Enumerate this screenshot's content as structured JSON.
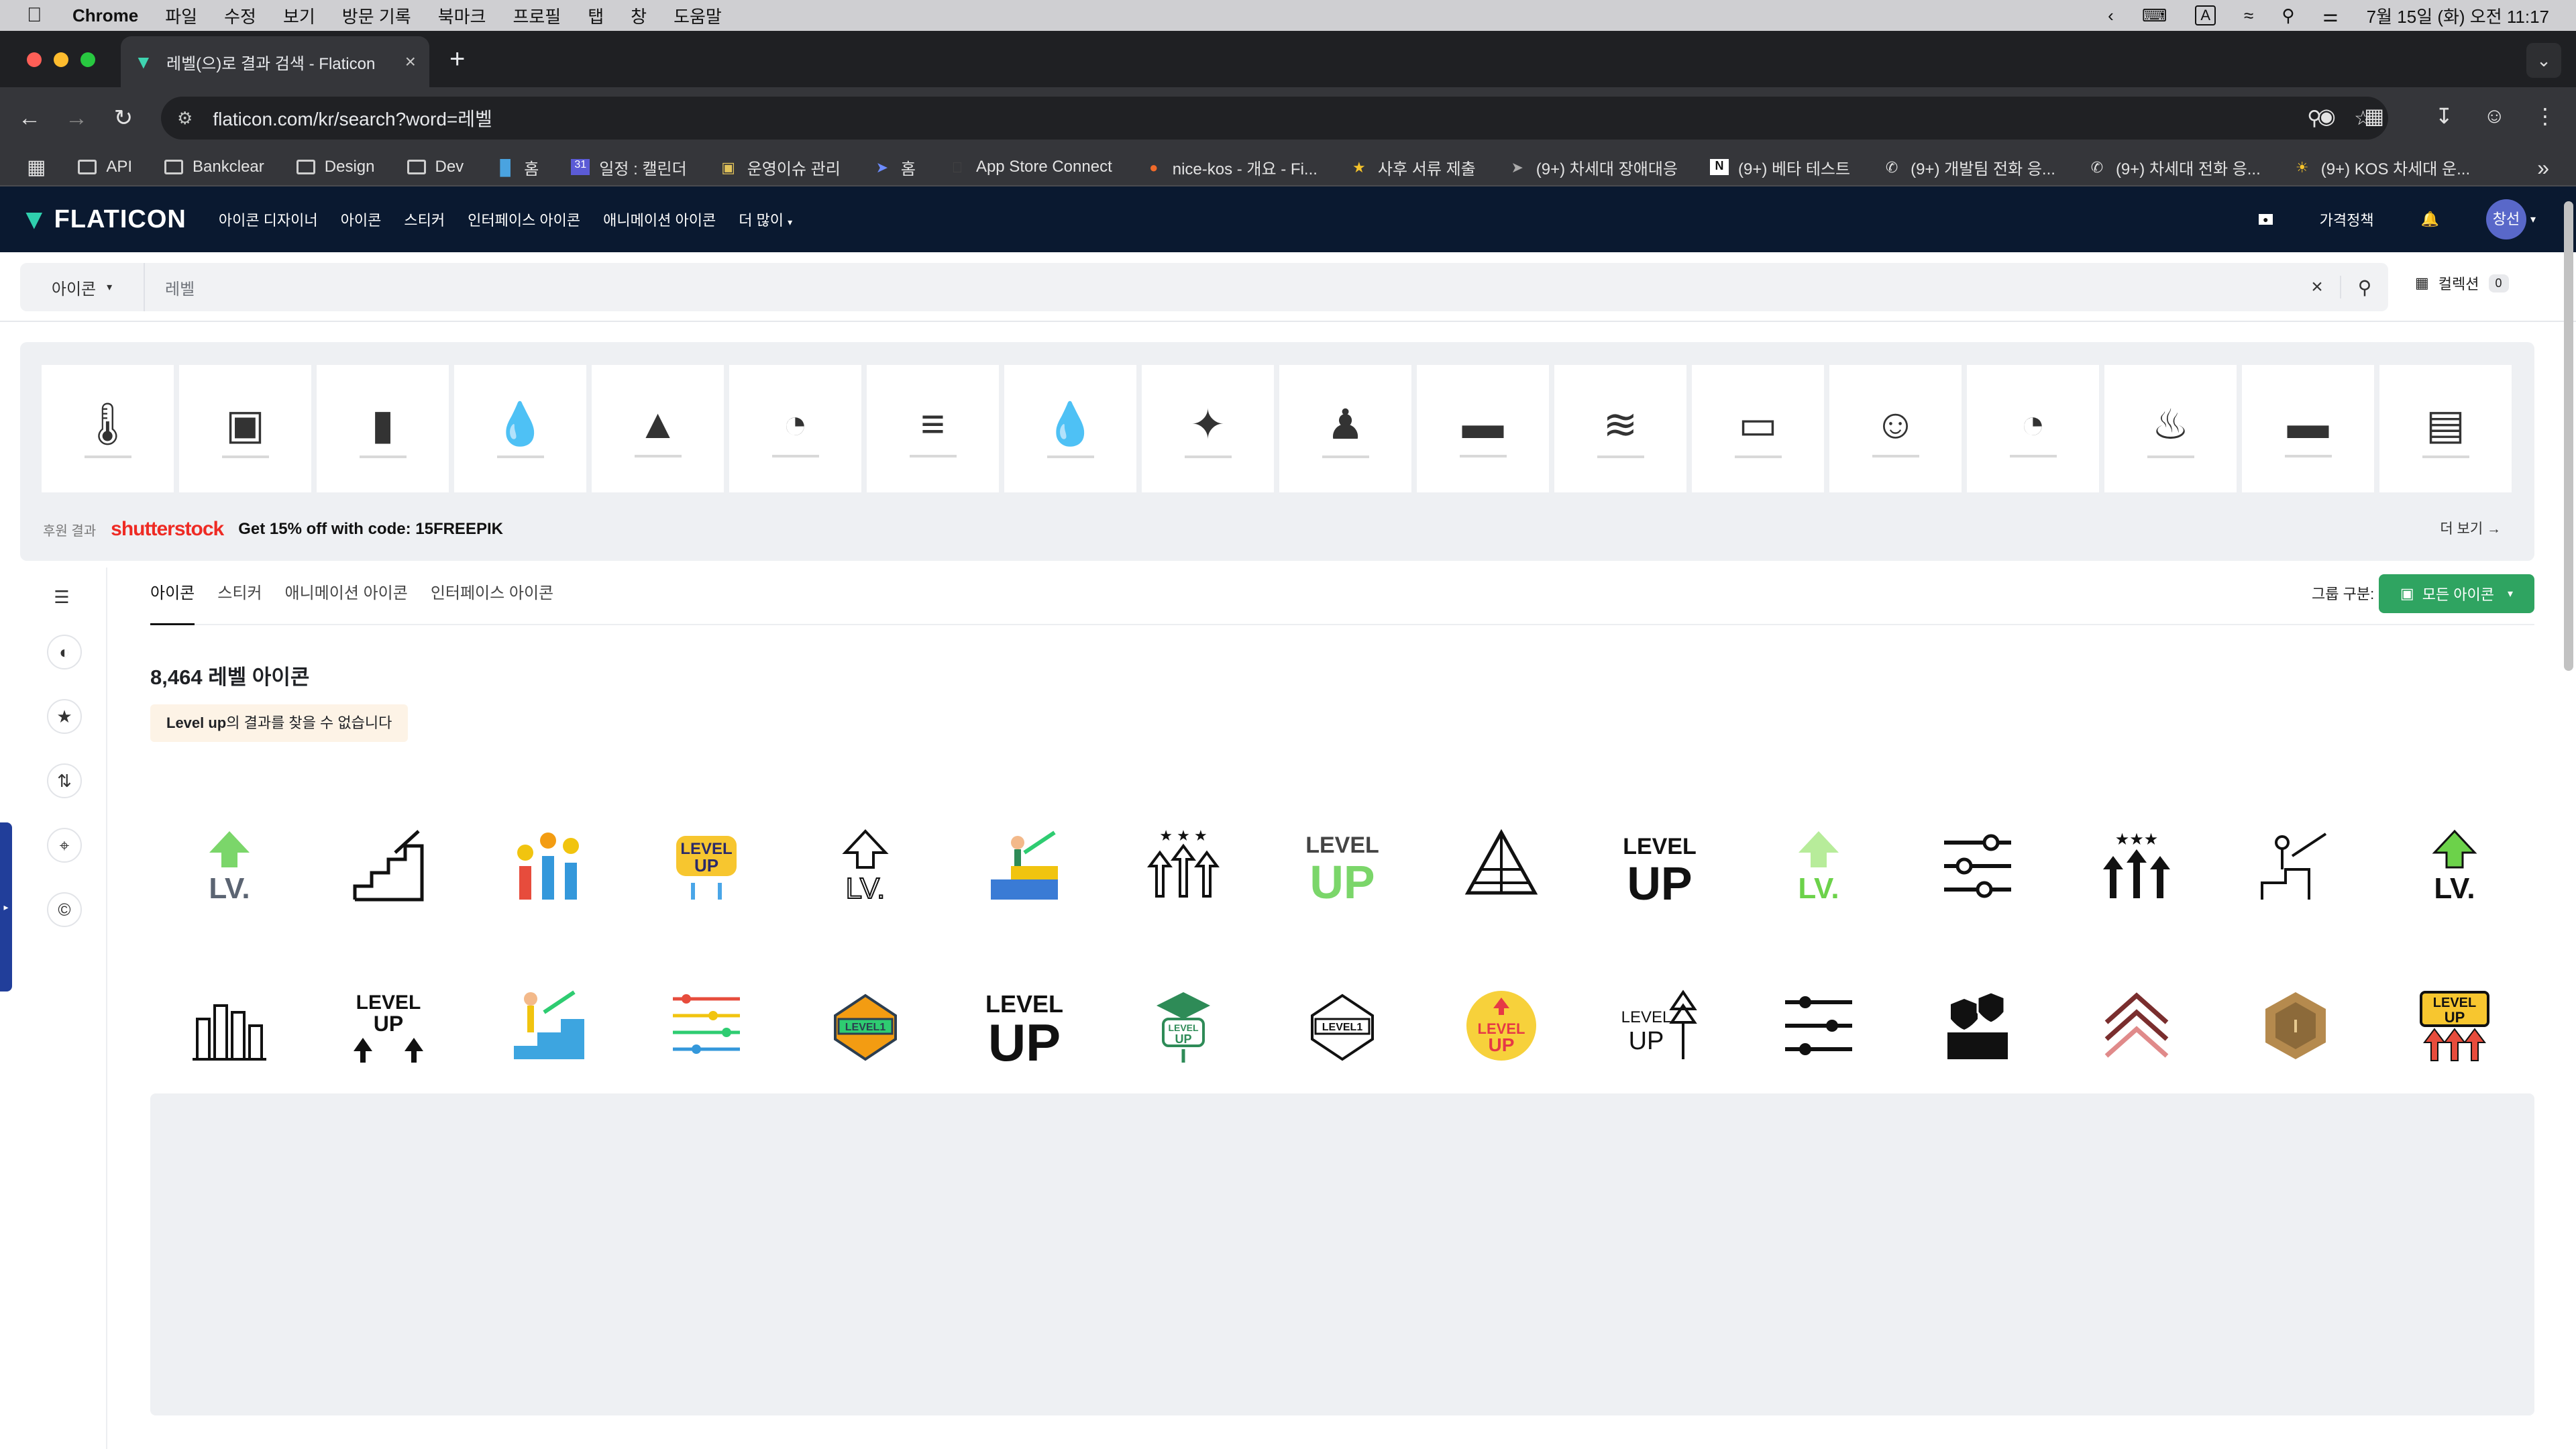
{
  "menubar": {
    "app": "Chrome",
    "items": [
      "파일",
      "수정",
      "보기",
      "방문 기록",
      "북마크",
      "프로필",
      "탭",
      "창",
      "도움말"
    ],
    "clock": "7월 15일 (화) 오전 11:17",
    "input_indicator": "A"
  },
  "browser": {
    "tab_title": "레벨(으)로 결과 검색 - Flaticon",
    "url": "flaticon.com/kr/search?word=레벨",
    "bookmarks": [
      {
        "label": "API",
        "icon": "folder-icon"
      },
      {
        "label": "Bankclear",
        "icon": "folder-icon"
      },
      {
        "label": "Design",
        "icon": "folder-icon"
      },
      {
        "label": "Dev",
        "icon": "folder-icon"
      },
      {
        "label": "홈",
        "icon": "site-icon"
      },
      {
        "label": "일정 : 캘린더",
        "icon": "calendar-icon"
      },
      {
        "label": "운영이슈 관리",
        "icon": "site-icon"
      },
      {
        "label": "홈",
        "icon": "site-icon"
      },
      {
        "label": "App Store Connect",
        "icon": "apple-icon"
      },
      {
        "label": "nice-kos - 개요 - Fi...",
        "icon": "site-icon"
      },
      {
        "label": "사후 서류 제출",
        "icon": "site-icon"
      },
      {
        "label": "(9+) 차세대 장애대응",
        "icon": "site-icon"
      },
      {
        "label": "(9+) 베타 테스트",
        "icon": "notion-icon"
      },
      {
        "label": "(9+) 개발팀 전화 응...",
        "icon": "phone-icon"
      },
      {
        "label": "(9+) 차세대 전화 응...",
        "icon": "phone-icon"
      },
      {
        "label": "(9+) KOS 차세대 운...",
        "icon": "sun-icon"
      }
    ]
  },
  "header": {
    "logo": "FLATICON",
    "nav": [
      "아이콘 디자이너",
      "아이콘",
      "스티커",
      "인터페이스 아이콘",
      "애니메이션 아이콘",
      "더 많이"
    ],
    "pricing": "가격정책",
    "avatar": "창선"
  },
  "search": {
    "type": "아이콘",
    "query": "레벨",
    "collections_label": "컬렉션",
    "collections_count": "0"
  },
  "sponsored": {
    "label": "후원 결과",
    "brand": "shutterstock",
    "promo": "Get 15% off with code: 15FREEPIK",
    "more": "더 보기 →",
    "tiles": [
      "thermometer-water-icon",
      "water-tank-icon",
      "ruler-level-icon",
      "water-drops-icon",
      "flood-mountain-icon",
      "gauge-speaker-icon",
      "water-ruler-icon",
      "humidity-percent-icon",
      "sparkle-level-icon",
      "climber-icon",
      "spirit-level-icon",
      "water-level-icon",
      "bubble-level-icon",
      "head-thought-icon",
      "gauge-meter-icon",
      "oil-can-icon",
      "tape-level-icon",
      "roof-rain-icon"
    ]
  },
  "tabs": [
    "아이콘",
    "스티커",
    "애니메이션 아이콘",
    "인터페이스 아이콘"
  ],
  "group": {
    "label": "그룹 구분:",
    "button": "모든 아이콘"
  },
  "results": {
    "count_text": "8,464 레벨 아이콘",
    "no_result_bold": "Level up",
    "no_result_rest": "의 결과를 찾을 수 없습니다"
  },
  "colors": {
    "header_bg": "#0a1930",
    "accent_green": "#2fa461",
    "brand_teal": "#2fcfae",
    "shutterstock_red": "#ee2b24"
  },
  "icons_row1": [
    "lv-up-arrow-green-icon",
    "stairs-arrow-icon",
    "stars-arrows-color-icon",
    "level-up-badge-icon",
    "lv-outline-arrow-icon",
    "person-steps-color-icon",
    "stars-arrows-outline-icon",
    "level-up-text-green-icon",
    "pyramid-icon",
    "level-up-text-black-icon",
    "lv-green-arrow-icon",
    "sliders-icon",
    "stars-arrows-solid-icon",
    "person-steps-outline-icon",
    "lv-up-arrow-black-icon"
  ],
  "icons_row2": [
    "bar-chart-building-icon",
    "level-up-arrows-icon",
    "person-climb-color-icon",
    "color-sliders-icon",
    "level-1-badge-color-icon",
    "level-up-bold-icon",
    "level-up-mortar-icon",
    "level-1-badge-outline-icon",
    "level-up-yellow-circle-icon",
    "level-up-tree-icon",
    "sliders-horizontal-icon",
    "podium-shields-icon",
    "double-chevron-up-icon",
    "hexagon-medal-icon",
    "level-up-arrows-color-icon"
  ]
}
